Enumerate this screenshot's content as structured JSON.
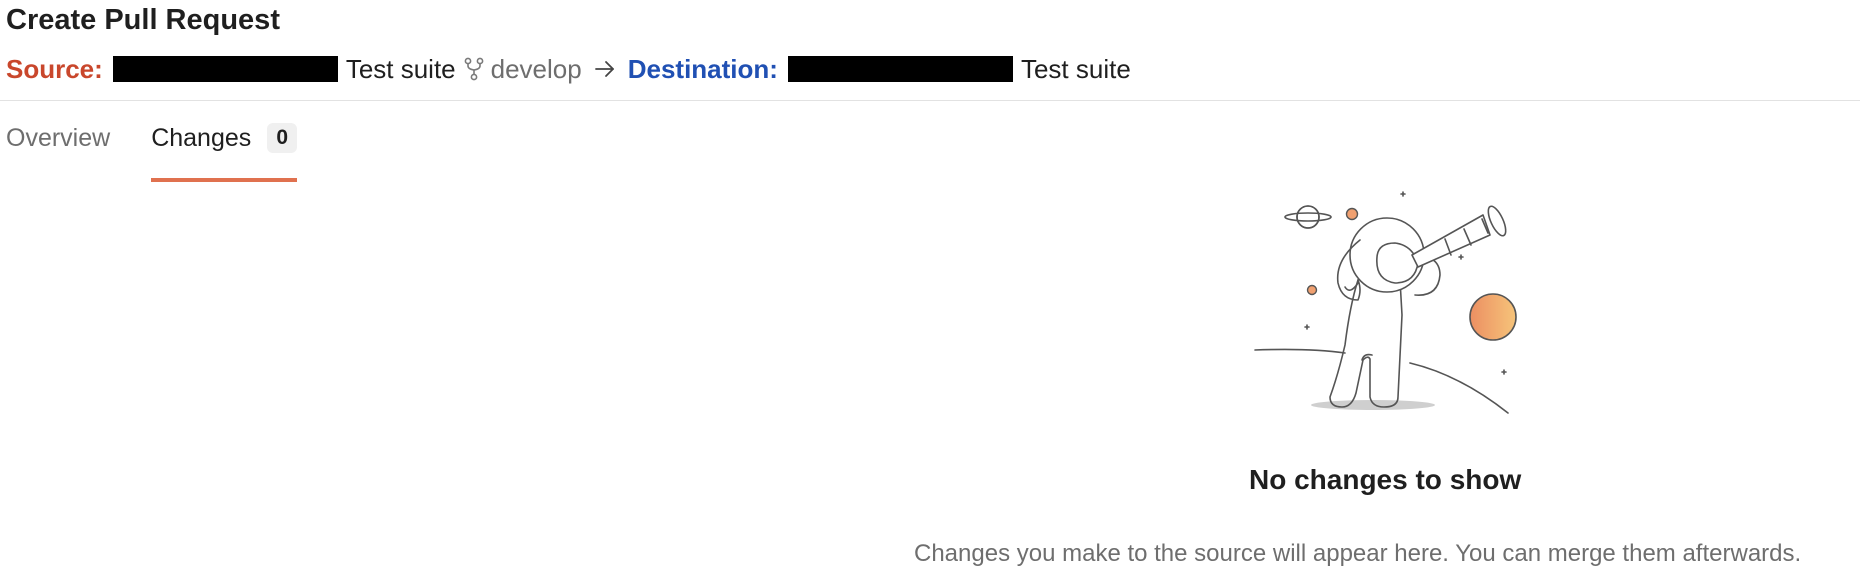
{
  "page": {
    "title": "Create Pull Request"
  },
  "pull_request": {
    "source_label": "Source:",
    "source_repo": "Test suite",
    "source_branch": "develop",
    "destination_label": "Destination:",
    "destination_repo": "Test suite"
  },
  "tabs": [
    {
      "label": "Overview",
      "active": false
    },
    {
      "label": "Changes",
      "active": true,
      "count": "0"
    }
  ],
  "empty_state": {
    "title": "No changes to show",
    "description": "Changes you make to the source will appear here. You can merge them afterwards."
  },
  "colors": {
    "source_label": "#c9472c",
    "destination_label": "#2050b3",
    "active_tab_underline": "#e0714f",
    "planet": "#f0a070"
  },
  "icons": {
    "branch": "git-branch-icon",
    "arrow": "arrow-right-icon",
    "illustration": "astronaut-telescope-illustration"
  }
}
